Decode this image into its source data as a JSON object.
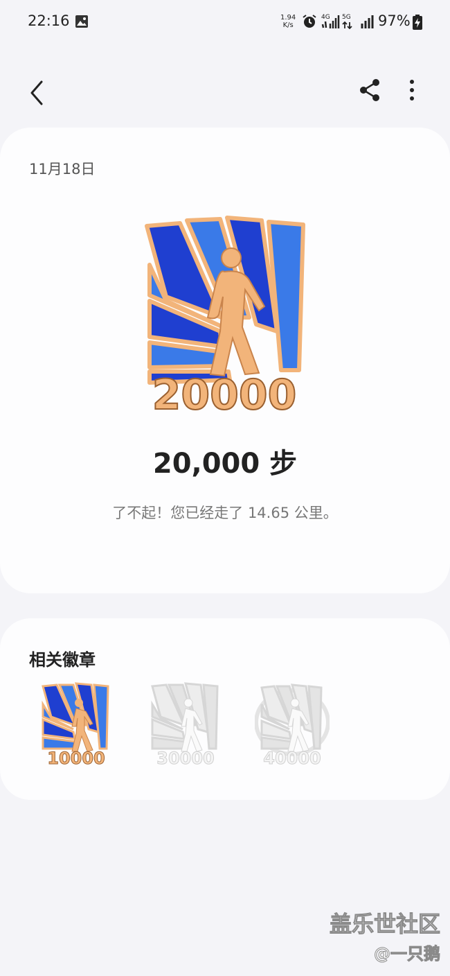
{
  "status_bar": {
    "time": "22:16",
    "net_speed_value": "1.94",
    "net_speed_unit": "K/s",
    "network_1": "4G",
    "network_2": "5G",
    "battery": "97%"
  },
  "header": {
    "back_icon": "chevron-left-icon",
    "share_icon": "share-icon",
    "more_icon": "more-vertical-icon"
  },
  "achievement": {
    "date": "11月18日",
    "badge_number": "20000",
    "steps": "20,000 步",
    "message": "了不起！您已经走了 14.65 公里。"
  },
  "related": {
    "title": "相关徽章",
    "badges": [
      {
        "number": "10000",
        "unlocked": true
      },
      {
        "number": "30000",
        "unlocked": false
      },
      {
        "number": "40000",
        "unlocked": false
      }
    ]
  },
  "watermark": {
    "line1": "盖乐世社区",
    "line2": "@一只鹅"
  },
  "colors": {
    "badge_blue_dark": "#1f3fd0",
    "badge_blue_light": "#3a7ae8",
    "badge_orange": "#f2b47a",
    "locked_gray": "#e0e0e0"
  }
}
